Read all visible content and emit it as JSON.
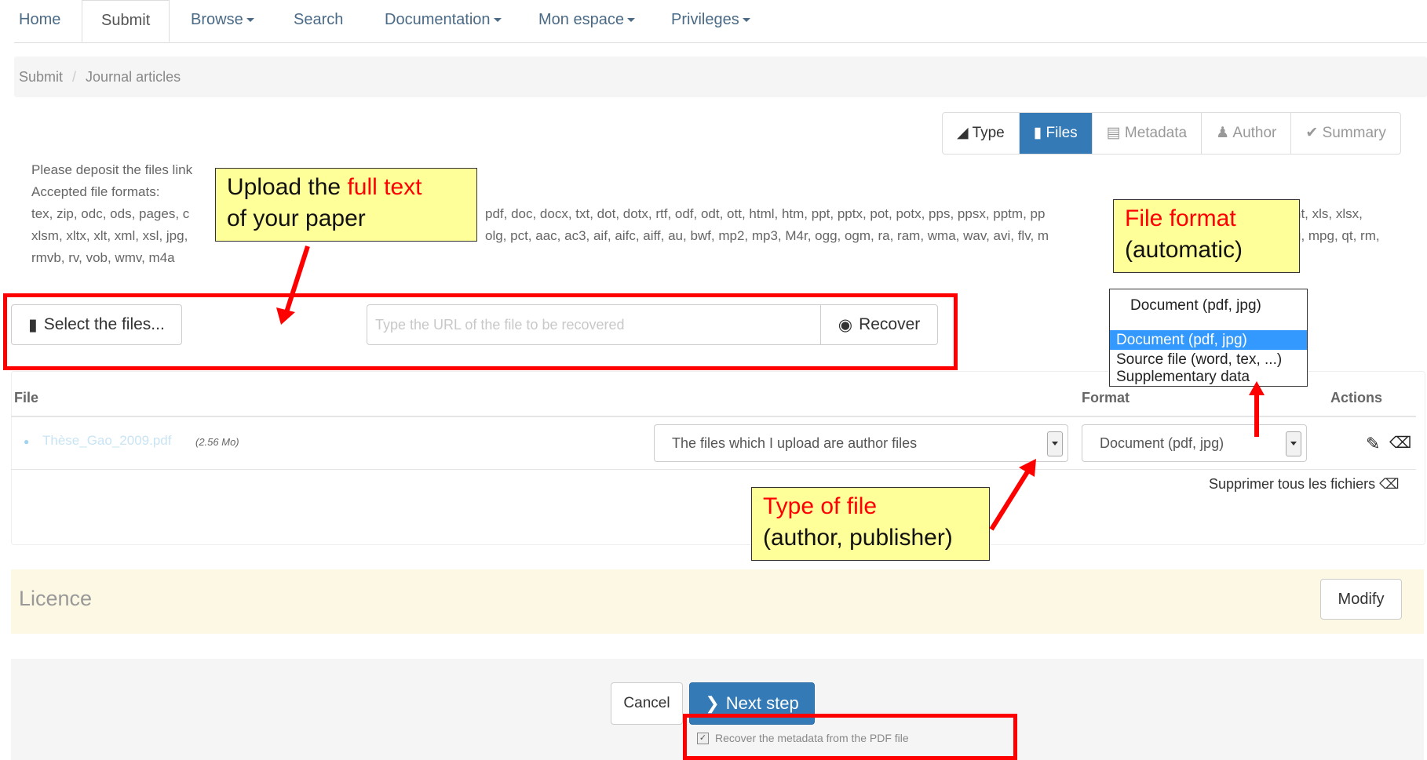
{
  "nav": {
    "items": [
      {
        "label": "Home"
      },
      {
        "label": "Submit"
      },
      {
        "label": "Browse"
      },
      {
        "label": "Search"
      },
      {
        "label": "Documentation"
      },
      {
        "label": "Mon espace"
      },
      {
        "label": "Privileges"
      }
    ],
    "active": "Submit"
  },
  "breadcrumb": {
    "items": [
      "Submit",
      "Journal articles"
    ],
    "separator": "/"
  },
  "steps": [
    {
      "label": "Type",
      "icon": "tag-icon"
    },
    {
      "label": "Files",
      "icon": "file-icon",
      "active": true
    },
    {
      "label": "Metadata",
      "icon": "list-icon"
    },
    {
      "label": "Author",
      "icon": "user-icon"
    },
    {
      "label": "Summary",
      "icon": "check-icon"
    }
  ],
  "intro": {
    "line1": "Please deposit the files link",
    "line2": "Accepted file formats:",
    "formats_line1_a": "tex, zip, odc, ods, pages, c",
    "formats_line1_b": "pdf, doc, docx, txt, dot, dotx, rtf, odf, odt, ott, html, htm, ppt, pptx, pot, potx, pps, ppsx, pptm, pp",
    "formats_line1_c": "nt, xls, xlsx,",
    "formats_line2_a": "xlsm, xltx, xlt, xml, xsl, jpg,",
    "formats_line2_b": "olg, pct, aac, ac3, aif, aifc, aiff, au, bwf, mp2, mp3, M4r, ogg, ogm, ra, ram, wma, wav, avi, flv, m",
    "formats_line2_c": "g, mpg, qt, rm,",
    "formats_line3": "rmvb, rv, vob, wmv, m4a"
  },
  "upload": {
    "select_label": "Select the files...",
    "url_placeholder": "Type the URL of the file to be recovered",
    "recover_label": "Recover"
  },
  "table": {
    "headers": {
      "file": "File",
      "format": "Format",
      "actions": "Actions"
    },
    "rows": [
      {
        "filename": "Thèse_Gao_2009.pdf",
        "size": "(2.56 Mo)",
        "type": "The files which I upload are author files",
        "format": "Document (pdf, jpg)"
      }
    ],
    "delete_all": "Supprimer tous les fichiers"
  },
  "dropdown": {
    "current": "Document (pdf, jpg)",
    "options": [
      "Document (pdf, jpg)",
      "Source file (word, tex, ...)",
      "Supplementary data"
    ],
    "selected_index": 0
  },
  "licence": {
    "title": "Licence",
    "modify_label": "Modify"
  },
  "footer": {
    "cancel_label": "Cancel",
    "next_label": "Next step",
    "recover_metadata_label": "Recover the metadata from the PDF file",
    "recover_metadata_checked": true
  },
  "callouts": {
    "upload_a": "Upload the ",
    "upload_red": "full text",
    "upload_b": "of your paper",
    "format_red": "File format",
    "format_b": "(automatic)",
    "type_red": "Type of file",
    "type_b": "(author, publisher)"
  },
  "colors": {
    "primary": "#337ab7",
    "annotation_red": "#ff0000",
    "callout_bg": "#ffff99",
    "licence_bg": "#fcf8e3"
  }
}
